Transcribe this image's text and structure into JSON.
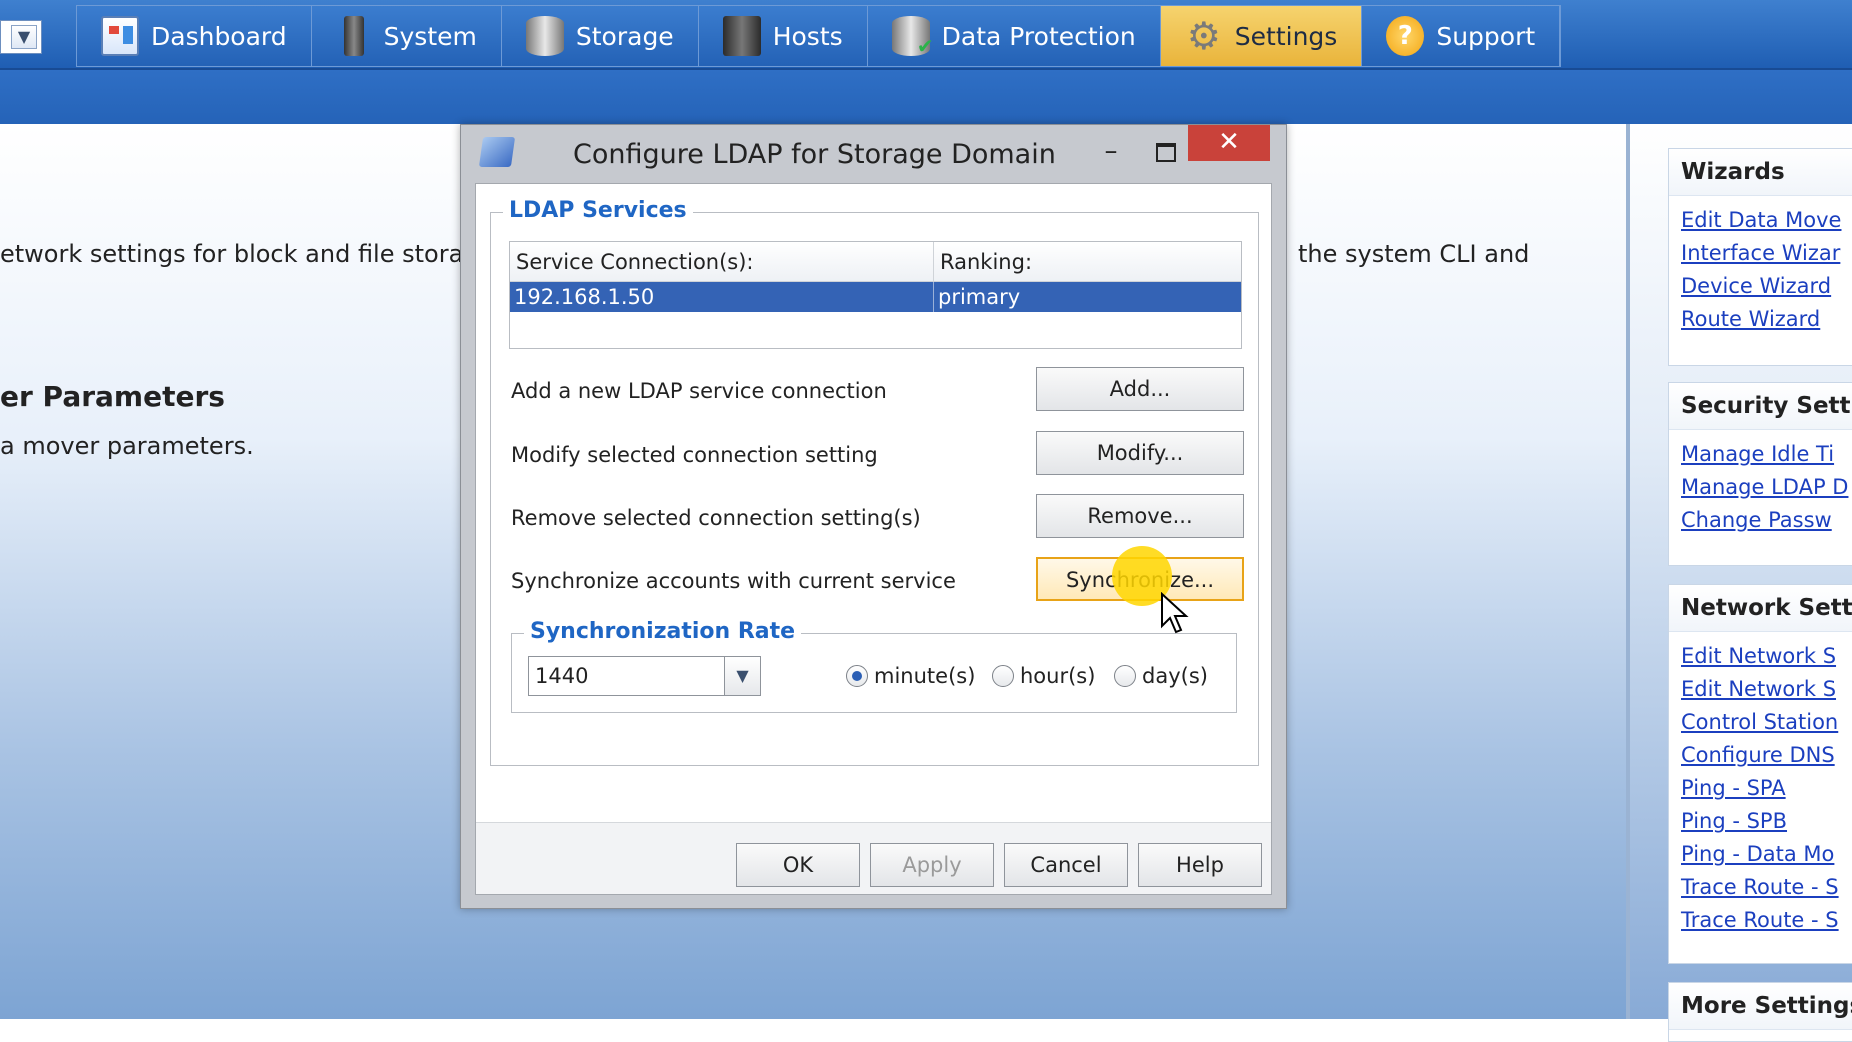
{
  "nav": {
    "tabs": [
      {
        "label": "Dashboard",
        "icon": "dashboard-icon"
      },
      {
        "label": "System",
        "icon": "server-icon"
      },
      {
        "label": "Storage",
        "icon": "storage-icon"
      },
      {
        "label": "Hosts",
        "icon": "hosts-icon"
      },
      {
        "label": "Data Protection",
        "icon": "data-protection-icon"
      },
      {
        "label": "Settings",
        "icon": "gear-icon",
        "active": true
      },
      {
        "label": "Support",
        "icon": "help-icon"
      }
    ],
    "dropdown_arrow": "▼"
  },
  "main": {
    "line1_left": "etwork settings for block and file stora",
    "line1_right": "the system CLI and",
    "heading": "er Parameters",
    "line2": "a mover parameters."
  },
  "right_panel": {
    "wizards": {
      "title": "Wizards",
      "links": [
        "Edit Data Move",
        "Interface Wizar",
        "Device Wizard",
        "Route Wizard"
      ]
    },
    "security": {
      "title": "Security Setting",
      "links": [
        "Manage Idle Ti",
        "Manage LDAP D",
        "Change Passw"
      ]
    },
    "network": {
      "title": "Network Setting",
      "links": [
        "Edit Network S",
        "Edit Network S",
        "Control Station",
        "Configure DNS",
        "Ping - SPA",
        "Ping - SPB",
        "Ping - Data Mo",
        "Trace Route - S",
        "Trace Route - S"
      ]
    },
    "more": {
      "title": "More Settings"
    }
  },
  "dialog": {
    "title": "Configure LDAP for Storage Domain",
    "close_glyph": "✕",
    "minimize_glyph": "–",
    "services": {
      "legend": "LDAP Services",
      "columns": [
        "Service Connection(s):",
        "Ranking:"
      ],
      "rows": [
        {
          "connection": "192.168.1.50",
          "ranking": "primary",
          "selected": true
        }
      ]
    },
    "actions": [
      {
        "label": "Add a new LDAP service connection",
        "button": "Add..."
      },
      {
        "label": "Modify selected connection setting",
        "button": "Modify..."
      },
      {
        "label": "Remove selected connection setting(s)",
        "button": "Remove..."
      },
      {
        "label": "Synchronize accounts with current service",
        "button": "Synchronize..."
      }
    ],
    "sync": {
      "legend": "Synchronization Rate",
      "value": "1440",
      "units": [
        {
          "label": "minute(s)",
          "selected": true
        },
        {
          "label": "hour(s)",
          "selected": false
        },
        {
          "label": "day(s)",
          "selected": false
        }
      ]
    },
    "footer": {
      "ok": "OK",
      "apply": "Apply",
      "cancel": "Cancel",
      "help": "Help"
    }
  }
}
